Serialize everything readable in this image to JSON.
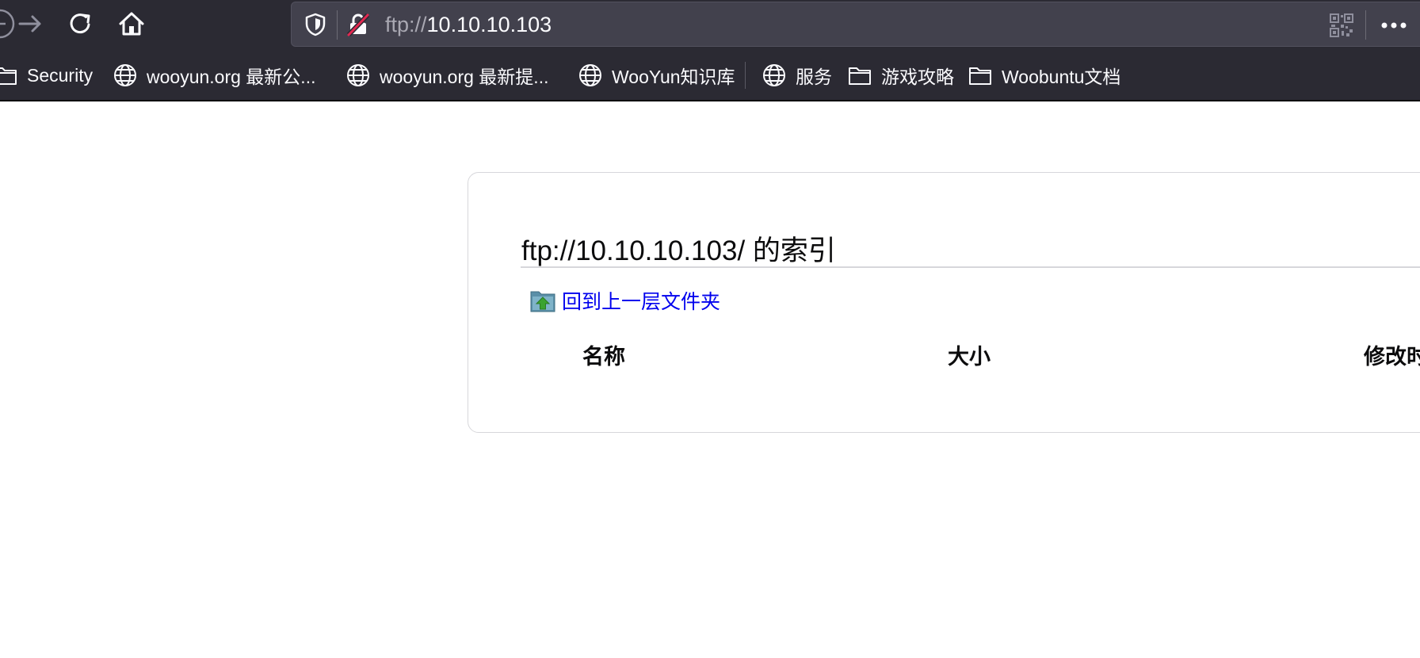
{
  "toolbar": {
    "url_scheme": "ftp://",
    "url_host": "10.10.10.103",
    "icons": [
      "back-icon",
      "forward-icon",
      "reload-icon",
      "home-icon",
      "shield-icon",
      "insecure-lock-icon",
      "qr-code-icon",
      "more-icon"
    ]
  },
  "bookmarks": [
    {
      "label": "Security",
      "icon": "folder-icon"
    },
    {
      "label": "wooyun.org 最新公...",
      "icon": "globe-icon"
    },
    {
      "label": "wooyun.org 最新提...",
      "icon": "globe-icon"
    },
    {
      "label": "WooYun知识库",
      "icon": "globe-icon"
    },
    {
      "label": "服务",
      "icon": "globe-icon"
    },
    {
      "label": "游戏攻略",
      "icon": "folder-icon"
    },
    {
      "label": "Woobuntu文档",
      "icon": "folder-icon"
    }
  ],
  "page": {
    "title": "ftp://10.10.10.103/ 的索引",
    "parent_link": "回到上一层文件夹",
    "columns": {
      "name": "名称",
      "size": "大小",
      "modified": "修改时"
    }
  },
  "colors": {
    "chrome_bg": "#2b2a33",
    "urlbar_bg": "#42414d",
    "link": "#0000ee",
    "insecure_red": "#e22850"
  }
}
